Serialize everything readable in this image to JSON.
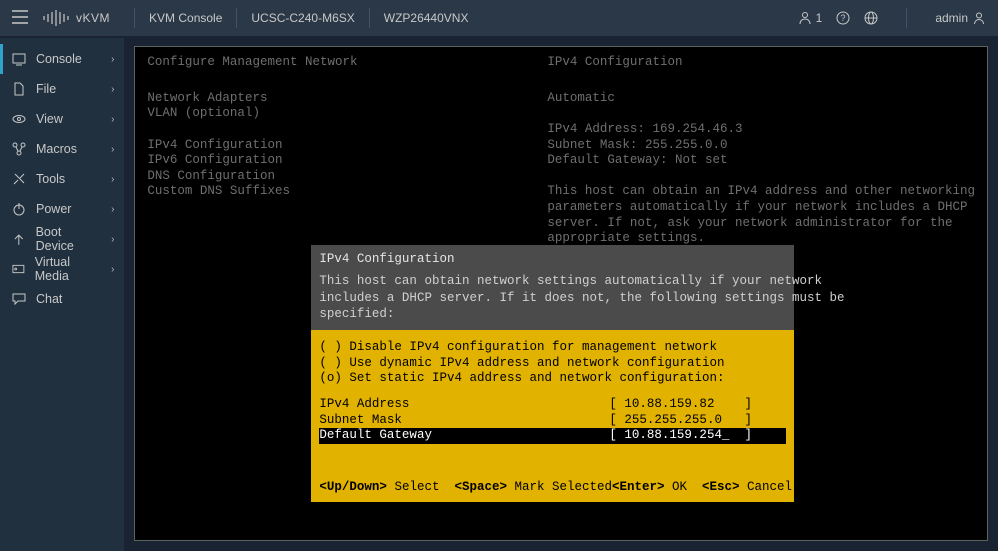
{
  "header": {
    "brand": "vKVM",
    "items": [
      "KVM Console",
      "UCSC-C240-M6SX",
      "WZP26440VNX"
    ],
    "user_count": "1",
    "username": "admin"
  },
  "sidebar": {
    "items": [
      {
        "label": "Console"
      },
      {
        "label": "File"
      },
      {
        "label": "View"
      },
      {
        "label": "Macros"
      },
      {
        "label": "Tools"
      },
      {
        "label": "Power"
      },
      {
        "label": "Boot Device"
      },
      {
        "label": "Virtual Media"
      },
      {
        "label": "Chat"
      }
    ]
  },
  "terminal": {
    "left_title": "Configure Management Network",
    "right_title": "IPv4 Configuration",
    "left_menu": "Network Adapters\nVLAN (optional)\n\nIPv4 Configuration\nIPv6 Configuration\nDNS Configuration\nCustom DNS Suffixes",
    "right_info": "Automatic\n\nIPv4 Address: 169.254.46.3\nSubnet Mask: 255.255.0.0\nDefault Gateway: Not set\n\nThis host can obtain an IPv4 address and other networking\nparameters automatically if your network includes a DHCP\nserver. If not, ask your network administrator for the\nappropriate settings."
  },
  "dialog": {
    "title": "IPv4 Configuration",
    "help": "This host can obtain network settings automatically if your network\nincludes a DHCP server. If it does not, the following settings must be\nspecified:",
    "opts": "( ) Disable IPv4 configuration for management network\n( ) Use dynamic IPv4 address and network configuration\n(o) Set static IPv4 address and network configuration:",
    "fields": [
      {
        "label": "IPv4 Address",
        "value": "[ 10.88.159.82    ]"
      },
      {
        "label": "Subnet Mask",
        "value": "[ 255.255.255.0   ]"
      },
      {
        "label": "Default Gateway",
        "value": "[ 10.88.159.254_  ]"
      }
    ],
    "foot_updown": "<Up/Down>",
    "foot_select": " Select  ",
    "foot_space": "<Space>",
    "foot_mark": " Mark Selected",
    "foot_enter": "<Enter>",
    "foot_ok": " OK  ",
    "foot_esc": "<Esc>",
    "foot_cancel": " Cancel"
  }
}
